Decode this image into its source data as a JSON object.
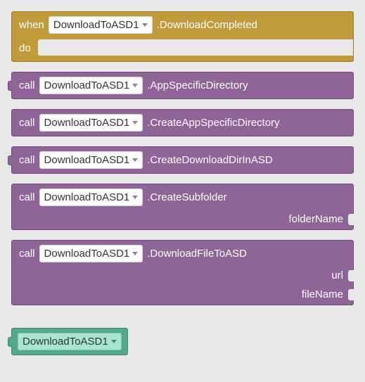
{
  "eventBlock": {
    "when": "when",
    "component": "DownloadToASD1",
    "event": ".DownloadCompleted",
    "do": "do"
  },
  "callBlocks": [
    {
      "call": "call",
      "component": "DownloadToASD1",
      "method": ".AppSpecificDirectory",
      "params": []
    },
    {
      "call": "call",
      "component": "DownloadToASD1",
      "method": ".CreateAppSpecificDirectory",
      "params": []
    },
    {
      "call": "call",
      "component": "DownloadToASD1",
      "method": ".CreateDownloadDirInASD",
      "params": []
    },
    {
      "call": "call",
      "component": "DownloadToASD1",
      "method": ".CreateSubfolder",
      "params": [
        "folderName"
      ]
    },
    {
      "call": "call",
      "component": "DownloadToASD1",
      "method": ".DownloadFileToASD",
      "params": [
        "url",
        "fileName"
      ]
    }
  ],
  "componentBlock": {
    "component": "DownloadToASD1"
  },
  "colors": {
    "gold": "#c19a3a",
    "purple": "#8f6497",
    "teal": "#53a98a"
  }
}
